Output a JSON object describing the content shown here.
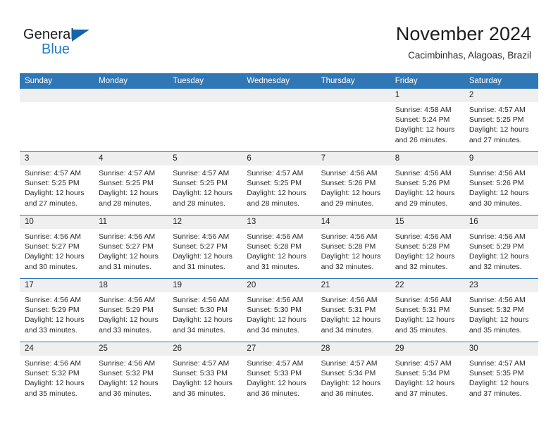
{
  "logo": {
    "word_one": "General",
    "word_two": "Blue",
    "triangle_color": "#1464aa",
    "blue_color": "#1f7cc4"
  },
  "header": {
    "title": "November 2024",
    "location": "Cacimbinhas, Alagoas, Brazil"
  },
  "theme": {
    "header_blue": "#3077b6",
    "daynum_grey": "#efefef",
    "text": "#2b2b2b"
  },
  "weekday_headers": [
    "Sunday",
    "Monday",
    "Tuesday",
    "Wednesday",
    "Thursday",
    "Friday",
    "Saturday"
  ],
  "labels": {
    "sunrise_prefix": "Sunrise:",
    "sunset_prefix": "Sunset:",
    "daylight_prefix": "Daylight:"
  },
  "weeks": [
    [
      {
        "day": "",
        "empty": true,
        "sunrise": "",
        "sunset": "",
        "daylight_line1": "",
        "daylight_line2": ""
      },
      {
        "day": "",
        "empty": true,
        "sunrise": "",
        "sunset": "",
        "daylight_line1": "",
        "daylight_line2": ""
      },
      {
        "day": "",
        "empty": true,
        "sunrise": "",
        "sunset": "",
        "daylight_line1": "",
        "daylight_line2": ""
      },
      {
        "day": "",
        "empty": true,
        "sunrise": "",
        "sunset": "",
        "daylight_line1": "",
        "daylight_line2": ""
      },
      {
        "day": "",
        "empty": true,
        "sunrise": "",
        "sunset": "",
        "daylight_line1": "",
        "daylight_line2": ""
      },
      {
        "day": "1",
        "empty": false,
        "sunrise": "Sunrise: 4:58 AM",
        "sunset": "Sunset: 5:24 PM",
        "daylight_line1": "Daylight: 12 hours",
        "daylight_line2": "and 26 minutes."
      },
      {
        "day": "2",
        "empty": false,
        "sunrise": "Sunrise: 4:57 AM",
        "sunset": "Sunset: 5:25 PM",
        "daylight_line1": "Daylight: 12 hours",
        "daylight_line2": "and 27 minutes."
      }
    ],
    [
      {
        "day": "3",
        "empty": false,
        "sunrise": "Sunrise: 4:57 AM",
        "sunset": "Sunset: 5:25 PM",
        "daylight_line1": "Daylight: 12 hours",
        "daylight_line2": "and 27 minutes."
      },
      {
        "day": "4",
        "empty": false,
        "sunrise": "Sunrise: 4:57 AM",
        "sunset": "Sunset: 5:25 PM",
        "daylight_line1": "Daylight: 12 hours",
        "daylight_line2": "and 28 minutes."
      },
      {
        "day": "5",
        "empty": false,
        "sunrise": "Sunrise: 4:57 AM",
        "sunset": "Sunset: 5:25 PM",
        "daylight_line1": "Daylight: 12 hours",
        "daylight_line2": "and 28 minutes."
      },
      {
        "day": "6",
        "empty": false,
        "sunrise": "Sunrise: 4:57 AM",
        "sunset": "Sunset: 5:25 PM",
        "daylight_line1": "Daylight: 12 hours",
        "daylight_line2": "and 28 minutes."
      },
      {
        "day": "7",
        "empty": false,
        "sunrise": "Sunrise: 4:56 AM",
        "sunset": "Sunset: 5:26 PM",
        "daylight_line1": "Daylight: 12 hours",
        "daylight_line2": "and 29 minutes."
      },
      {
        "day": "8",
        "empty": false,
        "sunrise": "Sunrise: 4:56 AM",
        "sunset": "Sunset: 5:26 PM",
        "daylight_line1": "Daylight: 12 hours",
        "daylight_line2": "and 29 minutes."
      },
      {
        "day": "9",
        "empty": false,
        "sunrise": "Sunrise: 4:56 AM",
        "sunset": "Sunset: 5:26 PM",
        "daylight_line1": "Daylight: 12 hours",
        "daylight_line2": "and 30 minutes."
      }
    ],
    [
      {
        "day": "10",
        "empty": false,
        "sunrise": "Sunrise: 4:56 AM",
        "sunset": "Sunset: 5:27 PM",
        "daylight_line1": "Daylight: 12 hours",
        "daylight_line2": "and 30 minutes."
      },
      {
        "day": "11",
        "empty": false,
        "sunrise": "Sunrise: 4:56 AM",
        "sunset": "Sunset: 5:27 PM",
        "daylight_line1": "Daylight: 12 hours",
        "daylight_line2": "and 31 minutes."
      },
      {
        "day": "12",
        "empty": false,
        "sunrise": "Sunrise: 4:56 AM",
        "sunset": "Sunset: 5:27 PM",
        "daylight_line1": "Daylight: 12 hours",
        "daylight_line2": "and 31 minutes."
      },
      {
        "day": "13",
        "empty": false,
        "sunrise": "Sunrise: 4:56 AM",
        "sunset": "Sunset: 5:28 PM",
        "daylight_line1": "Daylight: 12 hours",
        "daylight_line2": "and 31 minutes."
      },
      {
        "day": "14",
        "empty": false,
        "sunrise": "Sunrise: 4:56 AM",
        "sunset": "Sunset: 5:28 PM",
        "daylight_line1": "Daylight: 12 hours",
        "daylight_line2": "and 32 minutes."
      },
      {
        "day": "15",
        "empty": false,
        "sunrise": "Sunrise: 4:56 AM",
        "sunset": "Sunset: 5:28 PM",
        "daylight_line1": "Daylight: 12 hours",
        "daylight_line2": "and 32 minutes."
      },
      {
        "day": "16",
        "empty": false,
        "sunrise": "Sunrise: 4:56 AM",
        "sunset": "Sunset: 5:29 PM",
        "daylight_line1": "Daylight: 12 hours",
        "daylight_line2": "and 32 minutes."
      }
    ],
    [
      {
        "day": "17",
        "empty": false,
        "sunrise": "Sunrise: 4:56 AM",
        "sunset": "Sunset: 5:29 PM",
        "daylight_line1": "Daylight: 12 hours",
        "daylight_line2": "and 33 minutes."
      },
      {
        "day": "18",
        "empty": false,
        "sunrise": "Sunrise: 4:56 AM",
        "sunset": "Sunset: 5:29 PM",
        "daylight_line1": "Daylight: 12 hours",
        "daylight_line2": "and 33 minutes."
      },
      {
        "day": "19",
        "empty": false,
        "sunrise": "Sunrise: 4:56 AM",
        "sunset": "Sunset: 5:30 PM",
        "daylight_line1": "Daylight: 12 hours",
        "daylight_line2": "and 34 minutes."
      },
      {
        "day": "20",
        "empty": false,
        "sunrise": "Sunrise: 4:56 AM",
        "sunset": "Sunset: 5:30 PM",
        "daylight_line1": "Daylight: 12 hours",
        "daylight_line2": "and 34 minutes."
      },
      {
        "day": "21",
        "empty": false,
        "sunrise": "Sunrise: 4:56 AM",
        "sunset": "Sunset: 5:31 PM",
        "daylight_line1": "Daylight: 12 hours",
        "daylight_line2": "and 34 minutes."
      },
      {
        "day": "22",
        "empty": false,
        "sunrise": "Sunrise: 4:56 AM",
        "sunset": "Sunset: 5:31 PM",
        "daylight_line1": "Daylight: 12 hours",
        "daylight_line2": "and 35 minutes."
      },
      {
        "day": "23",
        "empty": false,
        "sunrise": "Sunrise: 4:56 AM",
        "sunset": "Sunset: 5:32 PM",
        "daylight_line1": "Daylight: 12 hours",
        "daylight_line2": "and 35 minutes."
      }
    ],
    [
      {
        "day": "24",
        "empty": false,
        "sunrise": "Sunrise: 4:56 AM",
        "sunset": "Sunset: 5:32 PM",
        "daylight_line1": "Daylight: 12 hours",
        "daylight_line2": "and 35 minutes."
      },
      {
        "day": "25",
        "empty": false,
        "sunrise": "Sunrise: 4:56 AM",
        "sunset": "Sunset: 5:32 PM",
        "daylight_line1": "Daylight: 12 hours",
        "daylight_line2": "and 36 minutes."
      },
      {
        "day": "26",
        "empty": false,
        "sunrise": "Sunrise: 4:57 AM",
        "sunset": "Sunset: 5:33 PM",
        "daylight_line1": "Daylight: 12 hours",
        "daylight_line2": "and 36 minutes."
      },
      {
        "day": "27",
        "empty": false,
        "sunrise": "Sunrise: 4:57 AM",
        "sunset": "Sunset: 5:33 PM",
        "daylight_line1": "Daylight: 12 hours",
        "daylight_line2": "and 36 minutes."
      },
      {
        "day": "28",
        "empty": false,
        "sunrise": "Sunrise: 4:57 AM",
        "sunset": "Sunset: 5:34 PM",
        "daylight_line1": "Daylight: 12 hours",
        "daylight_line2": "and 36 minutes."
      },
      {
        "day": "29",
        "empty": false,
        "sunrise": "Sunrise: 4:57 AM",
        "sunset": "Sunset: 5:34 PM",
        "daylight_line1": "Daylight: 12 hours",
        "daylight_line2": "and 37 minutes."
      },
      {
        "day": "30",
        "empty": false,
        "sunrise": "Sunrise: 4:57 AM",
        "sunset": "Sunset: 5:35 PM",
        "daylight_line1": "Daylight: 12 hours",
        "daylight_line2": "and 37 minutes."
      }
    ]
  ]
}
